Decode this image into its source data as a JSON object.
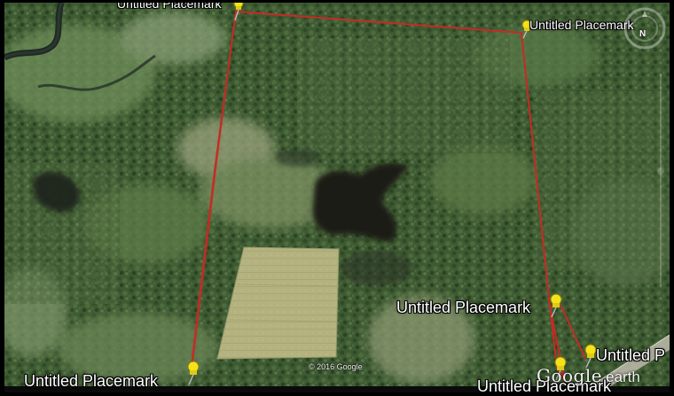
{
  "placemarks": [
    {
      "label": "Untitled Placemark"
    },
    {
      "label": "Untitled Placemark"
    },
    {
      "label": "Untitled Placemark"
    },
    {
      "label": "Untitled Placemark"
    },
    {
      "label": "Untitled Placemark"
    },
    {
      "label": "Untitled P"
    }
  ],
  "map": {
    "copyright": "© 2016 Google",
    "brand_google": "Google",
    "brand_earth": "earth",
    "compass_north": "N"
  },
  "colors": {
    "path_line": "#c62b25",
    "pin_yellow": "#f4e21a",
    "forest": "#3f5a33",
    "field": "#b2b07c",
    "water": "#1d211c"
  },
  "icons": {
    "placemark": "yellow-pushpin-icon",
    "compass": "compass-icon"
  }
}
